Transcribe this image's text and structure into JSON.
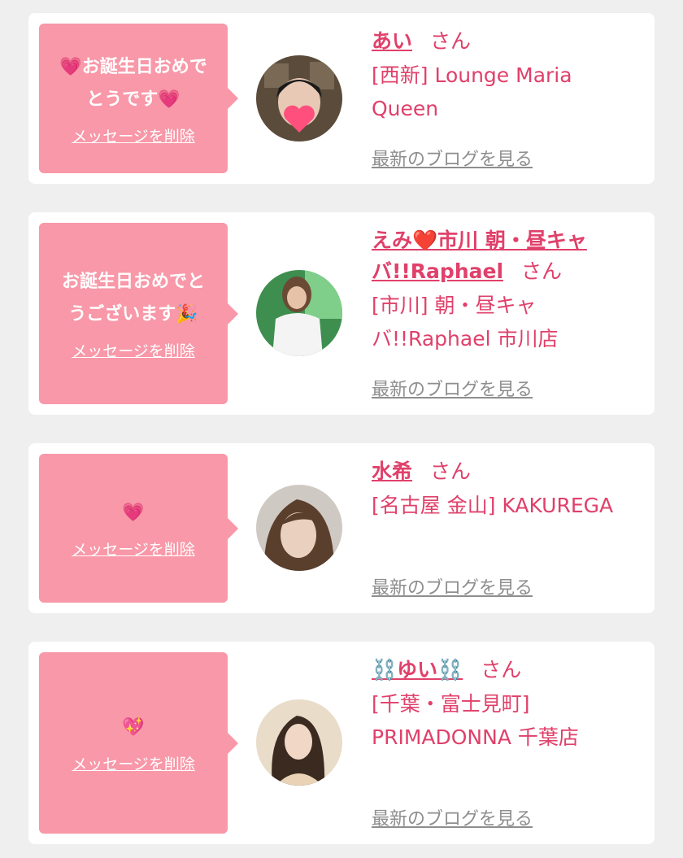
{
  "cards": [
    {
      "message": "💗お誕生日おめで\nとうです💗",
      "delete_label": "メッセージを削除",
      "name": "あい",
      "honorific": "さん",
      "shop": "[西新] Lounge Maria Queen",
      "blog_label": "最新のブログを見る"
    },
    {
      "message": "お誕生日おめでと\nうございます🎉",
      "delete_label": "メッセージを削除",
      "name": "えみ❤️市川 朝・昼キャバ!!Raphael",
      "honorific": "さん",
      "shop": "[市川] 朝・昼キャバ!!Raphael 市川店",
      "blog_label": "最新のブログを見る"
    },
    {
      "message": "💗",
      "delete_label": "メッセージを削除",
      "name": "水希",
      "honorific": "さん",
      "shop": "[名古屋 金山] KAKUREGA",
      "blog_label": "最新のブログを見る"
    },
    {
      "message": "💖",
      "delete_label": "メッセージを削除",
      "name": "⛓️ゆい⛓️",
      "honorific": "さん",
      "shop": "[千葉・富士見町] PRIMADONNA 千葉店",
      "blog_label": "最新のブログを見る"
    }
  ],
  "colors": {
    "bubble": "#f898a8",
    "accent": "#e0406a",
    "muted": "#8e8e8e"
  }
}
